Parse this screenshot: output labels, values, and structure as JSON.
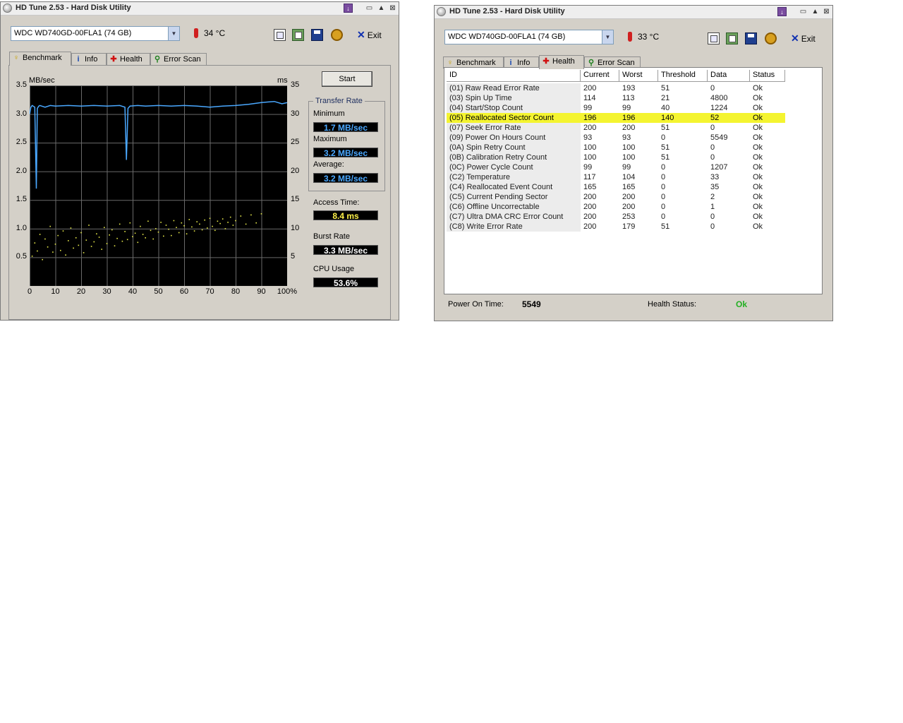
{
  "window_title": "HD Tune 2.53 - Hard Disk Utility",
  "titlebar_buttons": {
    "min": "▭",
    "max": "▲",
    "close": "⊠"
  },
  "colors": {
    "line": "#4aa8ff",
    "dots": "#e6e84a",
    "highlight": "#f4f430",
    "ok_green": "#23b023"
  },
  "toolbar": {
    "exit_label": "Exit"
  },
  "tabs": {
    "benchmark": "Benchmark",
    "info": "Info",
    "health": "Health",
    "error_scan": "Error Scan"
  },
  "left_window": {
    "drive": "WDC WD740GD-00FLA1 (74 GB)",
    "temperature": "34 °C",
    "start_button": "Start",
    "y_left_label": "MB/sec",
    "y_right_label": "ms",
    "transfer_rate_label": "Transfer Rate",
    "minimum_label": "Minimum",
    "minimum_value": "1.7 MB/sec",
    "maximum_label": "Maximum",
    "maximum_value": "3.2 MB/sec",
    "average_label": "Average:",
    "average_value": "3.2 MB/sec",
    "access_time_label": "Access Time:",
    "access_time_value": "8.4 ms",
    "burst_rate_label": "Burst Rate",
    "burst_rate_value": "3.3 MB/sec",
    "cpu_usage_label": "CPU Usage",
    "cpu_usage_value": "53.6%"
  },
  "chart_data": {
    "type": "line",
    "y_left_ticks": [
      "3.5",
      "3.0",
      "2.5",
      "2.0",
      "1.5",
      "1.0",
      "0.5"
    ],
    "y_right_ticks": [
      "35",
      "30",
      "25",
      "20",
      "15",
      "10",
      "5"
    ],
    "x_ticks": [
      "0",
      "10",
      "20",
      "30",
      "40",
      "50",
      "60",
      "70",
      "80",
      "90",
      "100%"
    ],
    "ylim": [
      0,
      3.5
    ],
    "y2lim": [
      0,
      35
    ],
    "xlim": [
      0,
      100
    ],
    "grid": true,
    "series": [
      {
        "name": "transfer rate",
        "axis": "MB/sec",
        "color": "#4aa8ff",
        "x": [
          0,
          0.5,
          1,
          2,
          2.6,
          3,
          3.6,
          4,
          6,
          8,
          10,
          15,
          20,
          25,
          30,
          35,
          37,
          37.6,
          38.2,
          39,
          42,
          45,
          50,
          55,
          60,
          65,
          70,
          75,
          80,
          85,
          90,
          95,
          98,
          100
        ],
        "y": [
          3.0,
          3.12,
          3.15,
          3.12,
          1.7,
          3.1,
          3.14,
          3.15,
          3.12,
          3.15,
          3.14,
          3.15,
          3.14,
          3.15,
          3.14,
          3.15,
          3.12,
          2.2,
          3.1,
          3.14,
          3.15,
          3.14,
          3.15,
          3.14,
          3.15,
          3.14,
          3.12,
          3.14,
          3.15,
          3.17,
          3.2,
          3.22,
          3.18,
          3.2
        ]
      },
      {
        "name": "access time",
        "axis": "ms",
        "color": "#e6e84a",
        "x": [
          1,
          2,
          3,
          4,
          5,
          6,
          7,
          8,
          9,
          10,
          11,
          12,
          13,
          14,
          15,
          16,
          17,
          18,
          19,
          20,
          21,
          22,
          23,
          24,
          25,
          26,
          27,
          28,
          29,
          30,
          31,
          32,
          33,
          34,
          35,
          36,
          37,
          38,
          39,
          40,
          41,
          42,
          43,
          44,
          45,
          46,
          47,
          48,
          49,
          50,
          51,
          52,
          53,
          54,
          55,
          56,
          57,
          58,
          59,
          60,
          61,
          62,
          63,
          64,
          65,
          66,
          67,
          68,
          69,
          70,
          71,
          72,
          73,
          74,
          75,
          76,
          77,
          78,
          79,
          80,
          82,
          84,
          86,
          88,
          90
        ],
        "y": [
          5.2,
          7.5,
          6.1,
          9.0,
          4.6,
          8.2,
          6.8,
          10.4,
          5.9,
          7.3,
          8.8,
          6.2,
          9.6,
          5.4,
          7.9,
          10.1,
          6.6,
          8.4,
          7.1,
          9.3,
          5.8,
          8.0,
          10.6,
          6.9,
          7.7,
          9.1,
          8.5,
          6.4,
          10.2,
          7.4,
          8.9,
          9.8,
          7.0,
          8.3,
          10.8,
          7.8,
          9.5,
          8.1,
          11.0,
          8.6,
          9.2,
          7.6,
          10.4,
          9.0,
          8.4,
          11.3,
          9.7,
          8.2,
          10.0,
          9.4,
          11.1,
          8.7,
          10.6,
          9.9,
          8.8,
          11.4,
          10.2,
          9.3,
          11.0,
          10.5,
          9.1,
          11.6,
          10.3,
          9.6,
          11.2,
          10.8,
          9.8,
          11.5,
          10.1,
          11.8,
          10.4,
          9.7,
          11.3,
          10.9,
          11.7,
          10.0,
          11.1,
          12.0,
          10.6,
          11.4,
          12.2,
          10.8,
          12.4,
          11.0,
          12.6
        ]
      }
    ]
  },
  "right_window": {
    "drive": "WDC WD740GD-00FLA1 (74 GB)",
    "temperature": "33 °C",
    "columns": [
      "ID",
      "Current",
      "Worst",
      "Threshold",
      "Data",
      "Status"
    ],
    "rows": [
      [
        "(01) Raw Read Error Rate",
        "200",
        "193",
        "51",
        "0",
        "Ok"
      ],
      [
        "(03) Spin Up Time",
        "114",
        "113",
        "21",
        "4800",
        "Ok"
      ],
      [
        "(04) Start/Stop Count",
        "99",
        "99",
        "40",
        "1224",
        "Ok"
      ],
      [
        "(05) Reallocated Sector Count",
        "196",
        "196",
        "140",
        "52",
        "Ok"
      ],
      [
        "(07) Seek Error Rate",
        "200",
        "200",
        "51",
        "0",
        "Ok"
      ],
      [
        "(09) Power On Hours Count",
        "93",
        "93",
        "0",
        "5549",
        "Ok"
      ],
      [
        "(0A) Spin Retry Count",
        "100",
        "100",
        "51",
        "0",
        "Ok"
      ],
      [
        "(0B) Calibration Retry Count",
        "100",
        "100",
        "51",
        "0",
        "Ok"
      ],
      [
        "(0C) Power Cycle Count",
        "99",
        "99",
        "0",
        "1207",
        "Ok"
      ],
      [
        "(C2) Temperature",
        "117",
        "104",
        "0",
        "33",
        "Ok"
      ],
      [
        "(C4) Reallocated Event Count",
        "165",
        "165",
        "0",
        "35",
        "Ok"
      ],
      [
        "(C5) Current Pending Sector",
        "200",
        "200",
        "0",
        "2",
        "Ok"
      ],
      [
        "(C6) Offline Uncorrectable",
        "200",
        "200",
        "0",
        "1",
        "Ok"
      ],
      [
        "(C7) Ultra DMA CRC Error Count",
        "200",
        "253",
        "0",
        "0",
        "Ok"
      ],
      [
        "(C8) Write Error Rate",
        "200",
        "179",
        "51",
        "0",
        "Ok"
      ]
    ],
    "highlight_row": 3,
    "power_on_time_label": "Power On Time:",
    "power_on_time_value": "5549",
    "health_status_label": "Health Status:",
    "health_status_value": "Ok"
  }
}
